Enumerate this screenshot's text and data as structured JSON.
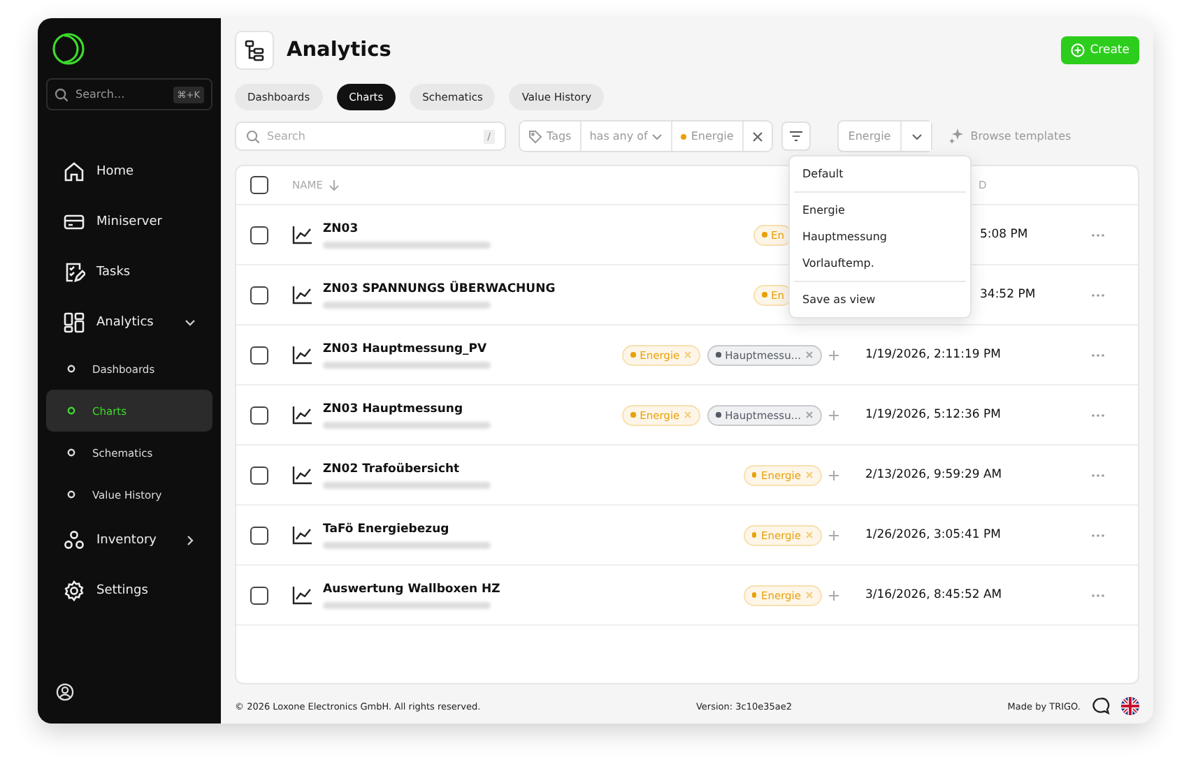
{
  "sidebar": {
    "search": {
      "placeholder": "Search...",
      "shortcut": "⌘+K"
    },
    "items": [
      {
        "label": "Home",
        "kind": "home",
        "selected": false
      },
      {
        "label": "Miniserver",
        "kind": "server",
        "selected": false
      },
      {
        "label": "Tasks",
        "kind": "tasks",
        "selected": false
      },
      {
        "label": "Analytics",
        "kind": "analytics",
        "selected": false,
        "expanded": true,
        "children": [
          {
            "label": "Dashboards",
            "selected": false
          },
          {
            "label": "Charts",
            "selected": true
          },
          {
            "label": "Schematics",
            "selected": false
          },
          {
            "label": "Value History",
            "selected": false
          }
        ]
      },
      {
        "label": "Inventory",
        "kind": "inventory",
        "selected": false,
        "expanded": false
      },
      {
        "label": "Settings",
        "kind": "settings",
        "selected": false
      }
    ]
  },
  "page": {
    "title": "Analytics",
    "create_button": "Create"
  },
  "tabs": [
    {
      "label": "Dashboards",
      "selected": false
    },
    {
      "label": "Charts",
      "selected": true
    },
    {
      "label": "Schematics",
      "selected": false
    },
    {
      "label": "Value History",
      "selected": false
    }
  ],
  "filter": {
    "search": {
      "placeholder": "Search",
      "shortcut": "/"
    },
    "tags": {
      "label": "Tags",
      "operator": "has any of",
      "value": "Energie",
      "color": "#e8a10a"
    },
    "view": "Energie",
    "browse": "Browse templates"
  },
  "menu": {
    "groups": [
      [
        "Default"
      ],
      [
        "Energie",
        "Hauptmessung",
        "Vorlauftemp."
      ],
      [
        "Save as view"
      ]
    ]
  },
  "table": {
    "all_checked": false,
    "columns": [
      {
        "label": "NAME",
        "sorted": true
      },
      {
        "label": "D"
      }
    ],
    "rows": [
      {
        "name": "ZN03",
        "tags": [
          {
            "label": "En",
            "color": "#e8a10a"
          }
        ],
        "date": "5:08 PM",
        "cut": true,
        "checked": false
      },
      {
        "name": "ZN03 SPANNUNGS ÜBERWACHUNG",
        "tags": [
          {
            "label": "En",
            "color": "#e8a10a"
          }
        ],
        "date": "34:52 PM",
        "cut": true,
        "checked": false
      },
      {
        "name": "ZN03 Hauptmessung_PV",
        "tags": [
          {
            "label": "Energie",
            "color": "#e8a10a"
          },
          {
            "label": "Hauptmessu...",
            "color": "#555b66"
          }
        ],
        "date": "1/19/2026, 2:11:19 PM",
        "cut": false,
        "checked": false
      },
      {
        "name": "ZN03 Hauptmessung",
        "tags": [
          {
            "label": "Energie",
            "color": "#e8a10a"
          },
          {
            "label": "Hauptmessu...",
            "color": "#555b66"
          }
        ],
        "date": "1/19/2026, 5:12:36 PM",
        "cut": false,
        "checked": false
      },
      {
        "name": "ZN02 Trafoübersicht",
        "tags": [
          {
            "label": "Energie",
            "color": "#e8a10a"
          }
        ],
        "date": "2/13/2026, 9:59:29 AM",
        "cut": false,
        "checked": false
      },
      {
        "name": "TaFö Energiebezug",
        "tags": [
          {
            "label": "Energie",
            "color": "#e8a10a"
          }
        ],
        "date": "1/26/2026, 3:05:41 PM",
        "cut": false,
        "checked": false
      },
      {
        "name": "Auswertung Wallboxen HZ",
        "tags": [
          {
            "label": "Energie",
            "color": "#e8a10a"
          }
        ],
        "date": "3/16/2026, 8:45:52 AM",
        "cut": false,
        "checked": false
      }
    ]
  },
  "footer": {
    "copyright": "© 2026 Loxone Electronics GmbH. All rights reserved.",
    "version": "Version: 3c10e35ae2",
    "made_by": "Made by TRIGO."
  }
}
